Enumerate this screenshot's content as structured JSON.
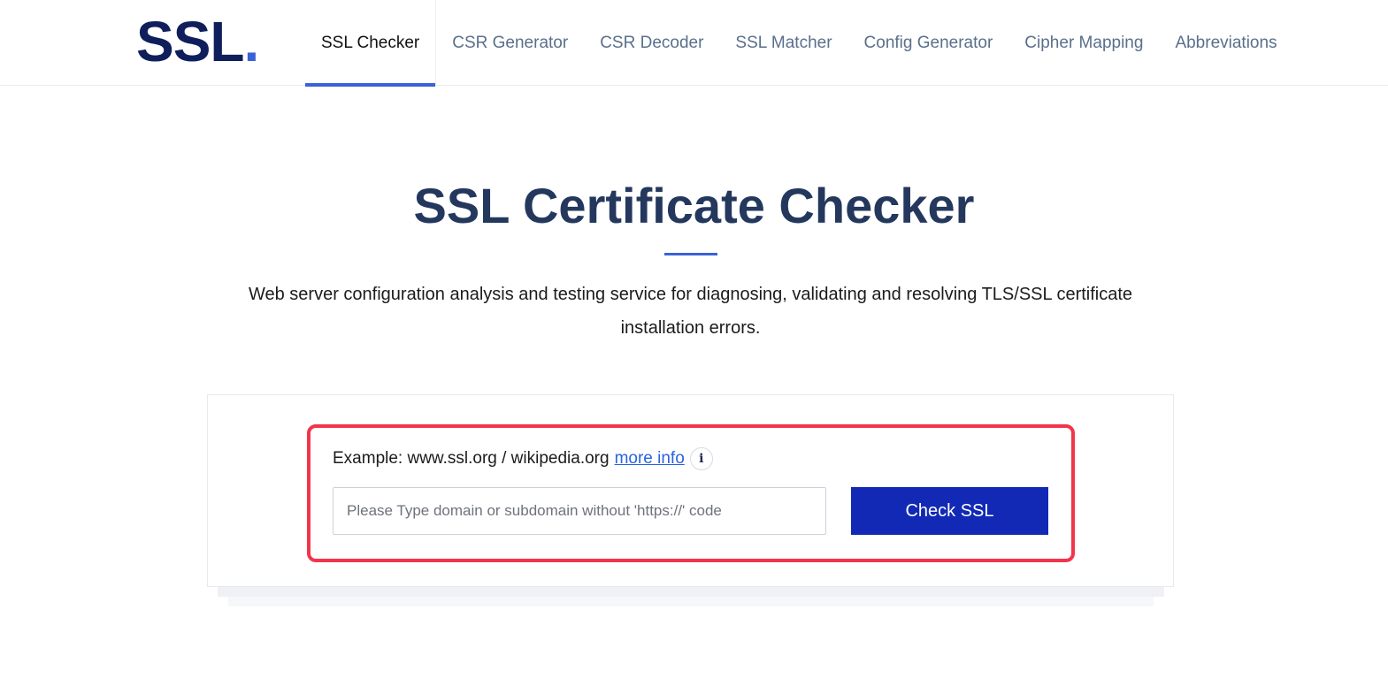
{
  "header": {
    "logo_text": "SSL",
    "logo_dot": ".",
    "nav": [
      {
        "label": "SSL Checker",
        "active": true
      },
      {
        "label": "CSR Generator",
        "active": false
      },
      {
        "label": "CSR Decoder",
        "active": false
      },
      {
        "label": "SSL Matcher",
        "active": false
      },
      {
        "label": "Config Generator",
        "active": false
      },
      {
        "label": "Cipher Mapping",
        "active": false
      },
      {
        "label": "Abbreviations",
        "active": false
      }
    ]
  },
  "hero": {
    "title": "SSL Certificate Checker",
    "subtitle_line1": "Web server configuration analysis and testing service for diagnosing, validating and resolving TLS/SSL certificate",
    "subtitle_line2": "installation errors."
  },
  "form": {
    "example_text": "Example: www.ssl.org / wikipedia.org",
    "more_info_label": "more info",
    "info_icon": "info-icon",
    "input_value": "",
    "input_placeholder": "Please Type domain or subdomain without 'https://' code",
    "button_label": "Check SSL"
  },
  "colors": {
    "brand_navy": "#0f1f5c",
    "accent_blue": "#3a62d6",
    "button_blue": "#1129b5",
    "highlight_red": "#f3344b",
    "link_blue": "#2a62e4"
  }
}
